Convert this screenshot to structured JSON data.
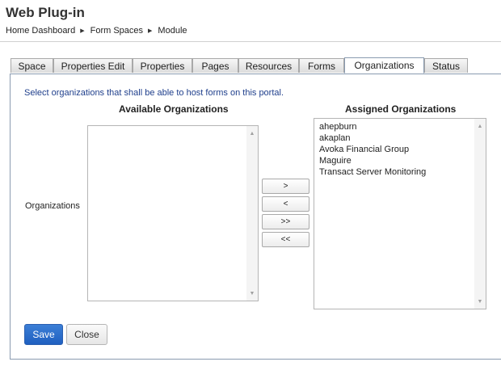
{
  "header": {
    "title": "Web Plug-in",
    "breadcrumb": [
      "Home Dashboard",
      "Form Spaces",
      "Module"
    ]
  },
  "tabs": [
    {
      "label": "Space",
      "active": false
    },
    {
      "label": "Properties Edit",
      "active": false
    },
    {
      "label": "Properties",
      "active": false
    },
    {
      "label": "Pages",
      "active": false
    },
    {
      "label": "Resources",
      "active": false
    },
    {
      "label": "Forms",
      "active": false
    },
    {
      "label": "Organizations",
      "active": true
    },
    {
      "label": "Status",
      "active": false
    }
  ],
  "form": {
    "instructions": "Select organizations that shall be able to host forms on this portal.",
    "available_heading": "Available Organizations",
    "assigned_heading": "Assigned Organizations",
    "row_label": "Organizations",
    "available_items": [],
    "assigned_items": [
      "ahepburn",
      "akaplan",
      "Avoka Financial Group",
      "Maguire",
      "Transact Server Monitoring"
    ],
    "move_buttons": [
      ">",
      "<",
      ">>",
      "<<"
    ]
  },
  "actions": {
    "save_label": "Save",
    "close_label": "Close"
  },
  "colors": {
    "accent": "#1f5fc0",
    "instruction_text": "#1f3f8c"
  }
}
